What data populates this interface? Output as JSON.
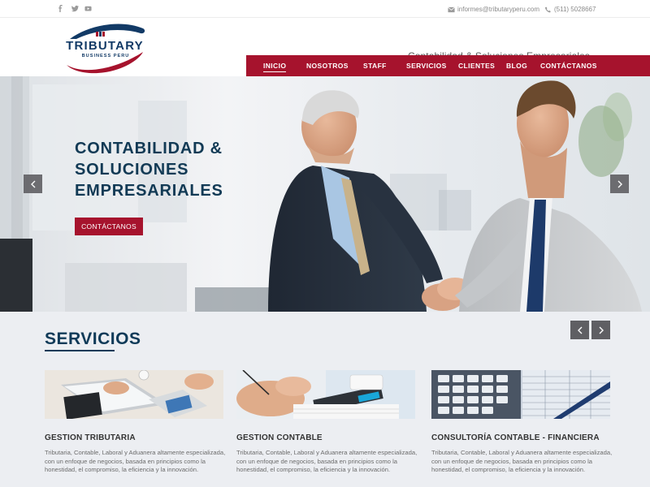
{
  "topbar": {
    "social": [
      {
        "name": "facebook-icon"
      },
      {
        "name": "twitter-icon"
      },
      {
        "name": "youtube-icon"
      }
    ],
    "email": "informes@tributaryperu.com",
    "phone": "(511) 5028667"
  },
  "header": {
    "logo_text": "TRIBUTARY",
    "logo_subtext": "BUSINESS PERU",
    "tagline": "Contabilidad & Soluciones Empresariales"
  },
  "nav": {
    "items": [
      {
        "label": "INICIO",
        "active": true
      },
      {
        "label": "NOSOTROS"
      },
      {
        "label": "STAFF"
      },
      {
        "label": "SERVICIOS"
      },
      {
        "label": "CLIENTES"
      },
      {
        "label": "BLOG"
      },
      {
        "label": "CONTÁCTANOS"
      }
    ]
  },
  "hero": {
    "title": "CONTABILIDAD &\nSOLUCIONES\nEMPRESARIALES",
    "cta": "CONTÁCTANOS",
    "prev_icon": "chevron-left-icon",
    "next_icon": "chevron-right-icon"
  },
  "services": {
    "title": "SERVICIOS",
    "cards": [
      {
        "title": "GESTION TRIBUTARIA",
        "text": "Tributaria, Contable, Laboral y Aduanera altamente especializada, con un enfoque de negocios, basada en principios como la honestidad, el compromiso, la eficiencia y la innovación."
      },
      {
        "title": "GESTION CONTABLE",
        "text": "Tributaria, Contable, Laboral y Aduanera altamente especializada, con un enfoque de negocios, basada en principios como la honestidad, el compromiso, la eficiencia y la innovación."
      },
      {
        "title": "CONSULTORÍA CONTABLE - FINANCIERA",
        "text": "Tributaria, Contable, Laboral y Aduanera altamente especializada, con un enfoque de negocios, basada en principios como la honestidad, el compromiso, la eficiencia y la innovación."
      }
    ]
  },
  "colors": {
    "brand_red": "#a6132d",
    "brand_navy": "#0f3a58",
    "arrow_gray": "#5f5f63"
  }
}
